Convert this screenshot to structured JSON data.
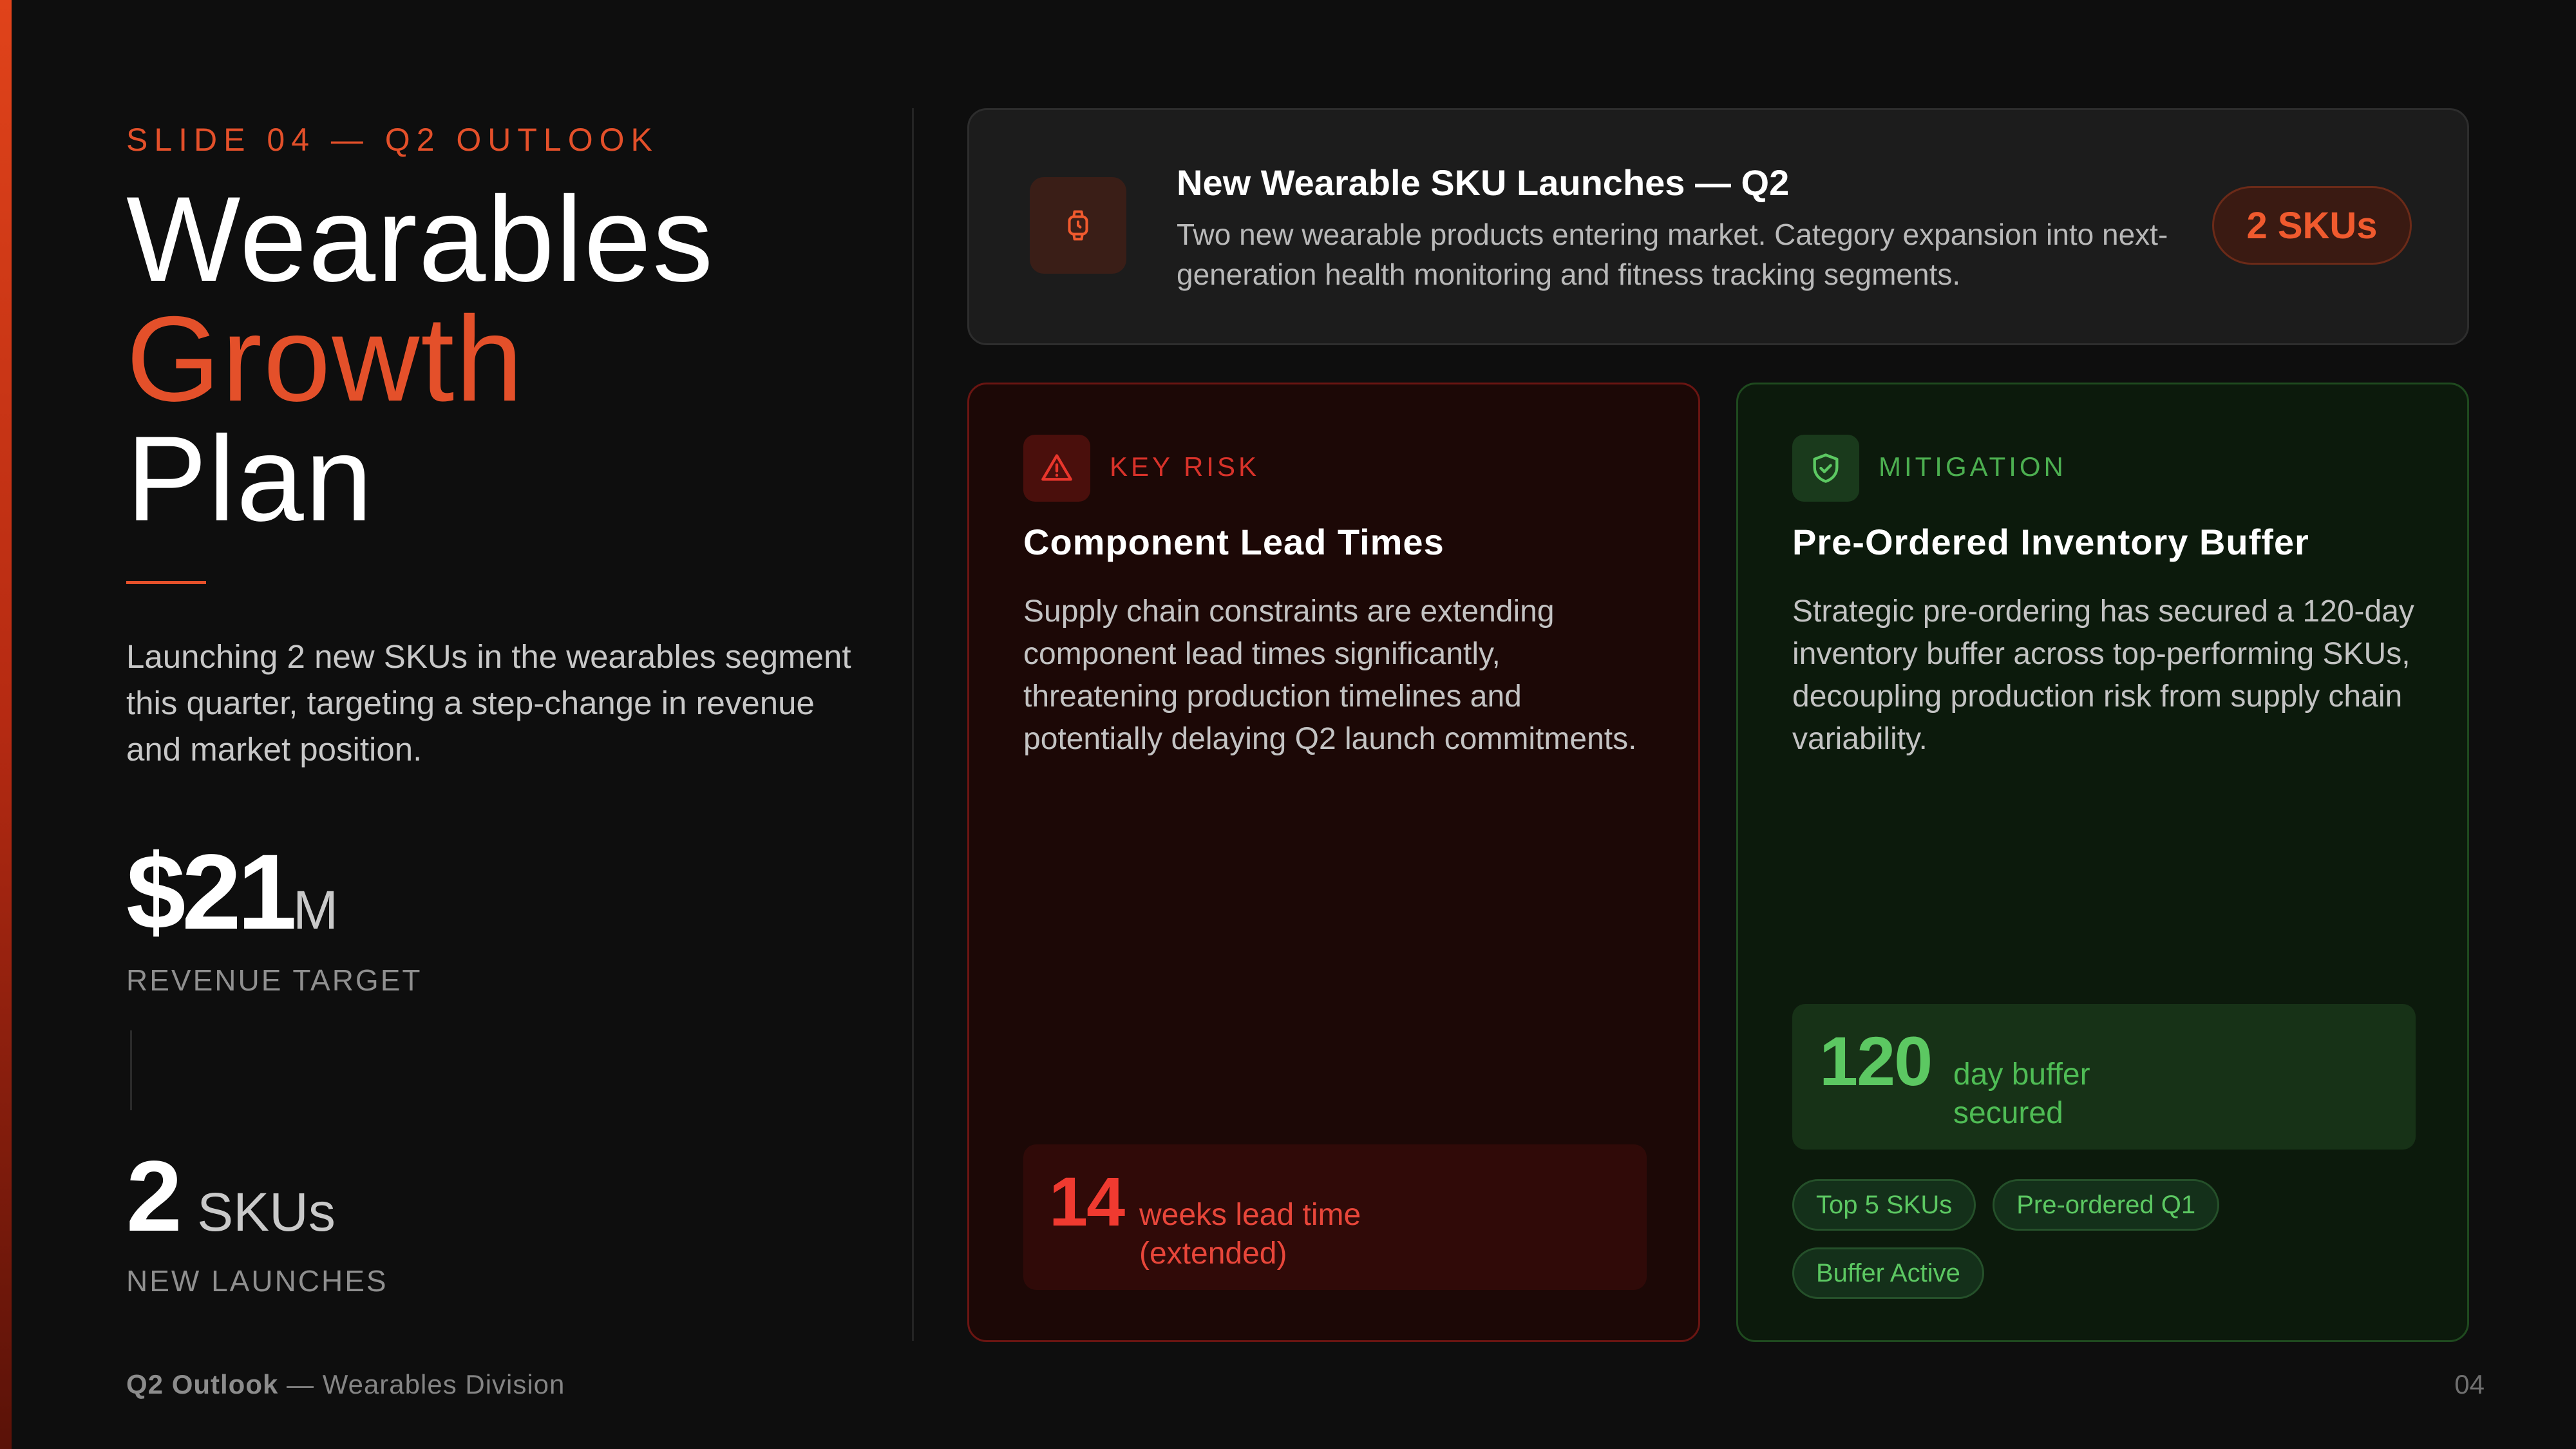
{
  "slide": {
    "eyebrow": "SLIDE 04 — Q2 OUTLOOK",
    "title_line1": "Wearables",
    "title_line2": "Growth",
    "title_line3": "Plan",
    "lede": "Launching 2 new SKUs in the wearables segment this quarter, targeting a step-change in revenue and market position.",
    "accent_color": "#e4502a"
  },
  "stats": [
    {
      "value": "$21",
      "unit": "M",
      "label": "REVENUE TARGET"
    },
    {
      "value": "2",
      "unit": " SKUs",
      "label": "NEW LAUNCHES"
    }
  ],
  "launch_card": {
    "icon": "watch-icon",
    "title": "New Wearable SKU Launches — Q2",
    "description": "Two new wearable products entering market. Category expansion into next-generation health monitoring and fitness tracking segments.",
    "badge": "2 SKUs"
  },
  "risk_card": {
    "icon": "warning-icon",
    "tag": "KEY RISK",
    "title": "Component Lead Times",
    "body": "Supply chain constraints are extending component lead times significantly, threatening production timelines and potentially delaying Q2 launch commitments.",
    "metric_value": "14",
    "metric_line1": "weeks lead time",
    "metric_line2": "(extended)",
    "color": "#f03a30"
  },
  "mitigation_card": {
    "icon": "shield-check-icon",
    "tag": "MITIGATION",
    "title": "Pre-Ordered Inventory Buffer",
    "body": "Strategic pre-ordering has secured a 120-day inventory buffer across top-performing SKUs, decoupling production risk from supply chain variability.",
    "metric_value": "120",
    "metric_line1": "day buffer",
    "metric_line2": "secured",
    "chips": [
      "Top 5 SKUs",
      "Pre-ordered Q1",
      "Buffer Active"
    ],
    "color": "#5cc862"
  },
  "footer": {
    "bold": "Q2 Outlook",
    "rest": " — Wearables Division",
    "page": "04"
  }
}
